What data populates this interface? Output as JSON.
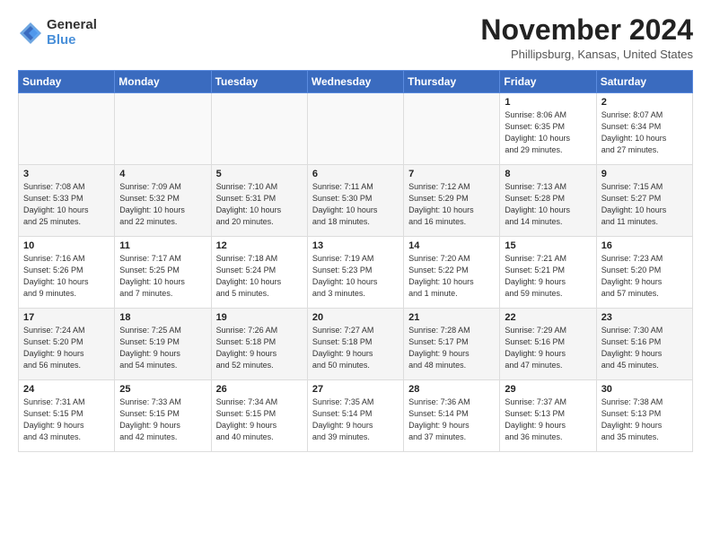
{
  "header": {
    "logo_general": "General",
    "logo_blue": "Blue",
    "month_title": "November 2024",
    "location": "Phillipsburg, Kansas, United States"
  },
  "weekdays": [
    "Sunday",
    "Monday",
    "Tuesday",
    "Wednesday",
    "Thursday",
    "Friday",
    "Saturday"
  ],
  "weeks": [
    [
      {
        "day": "",
        "info": ""
      },
      {
        "day": "",
        "info": ""
      },
      {
        "day": "",
        "info": ""
      },
      {
        "day": "",
        "info": ""
      },
      {
        "day": "",
        "info": ""
      },
      {
        "day": "1",
        "info": "Sunrise: 8:06 AM\nSunset: 6:35 PM\nDaylight: 10 hours\nand 29 minutes."
      },
      {
        "day": "2",
        "info": "Sunrise: 8:07 AM\nSunset: 6:34 PM\nDaylight: 10 hours\nand 27 minutes."
      }
    ],
    [
      {
        "day": "3",
        "info": "Sunrise: 7:08 AM\nSunset: 5:33 PM\nDaylight: 10 hours\nand 25 minutes."
      },
      {
        "day": "4",
        "info": "Sunrise: 7:09 AM\nSunset: 5:32 PM\nDaylight: 10 hours\nand 22 minutes."
      },
      {
        "day": "5",
        "info": "Sunrise: 7:10 AM\nSunset: 5:31 PM\nDaylight: 10 hours\nand 20 minutes."
      },
      {
        "day": "6",
        "info": "Sunrise: 7:11 AM\nSunset: 5:30 PM\nDaylight: 10 hours\nand 18 minutes."
      },
      {
        "day": "7",
        "info": "Sunrise: 7:12 AM\nSunset: 5:29 PM\nDaylight: 10 hours\nand 16 minutes."
      },
      {
        "day": "8",
        "info": "Sunrise: 7:13 AM\nSunset: 5:28 PM\nDaylight: 10 hours\nand 14 minutes."
      },
      {
        "day": "9",
        "info": "Sunrise: 7:15 AM\nSunset: 5:27 PM\nDaylight: 10 hours\nand 11 minutes."
      }
    ],
    [
      {
        "day": "10",
        "info": "Sunrise: 7:16 AM\nSunset: 5:26 PM\nDaylight: 10 hours\nand 9 minutes."
      },
      {
        "day": "11",
        "info": "Sunrise: 7:17 AM\nSunset: 5:25 PM\nDaylight: 10 hours\nand 7 minutes."
      },
      {
        "day": "12",
        "info": "Sunrise: 7:18 AM\nSunset: 5:24 PM\nDaylight: 10 hours\nand 5 minutes."
      },
      {
        "day": "13",
        "info": "Sunrise: 7:19 AM\nSunset: 5:23 PM\nDaylight: 10 hours\nand 3 minutes."
      },
      {
        "day": "14",
        "info": "Sunrise: 7:20 AM\nSunset: 5:22 PM\nDaylight: 10 hours\nand 1 minute."
      },
      {
        "day": "15",
        "info": "Sunrise: 7:21 AM\nSunset: 5:21 PM\nDaylight: 9 hours\nand 59 minutes."
      },
      {
        "day": "16",
        "info": "Sunrise: 7:23 AM\nSunset: 5:20 PM\nDaylight: 9 hours\nand 57 minutes."
      }
    ],
    [
      {
        "day": "17",
        "info": "Sunrise: 7:24 AM\nSunset: 5:20 PM\nDaylight: 9 hours\nand 56 minutes."
      },
      {
        "day": "18",
        "info": "Sunrise: 7:25 AM\nSunset: 5:19 PM\nDaylight: 9 hours\nand 54 minutes."
      },
      {
        "day": "19",
        "info": "Sunrise: 7:26 AM\nSunset: 5:18 PM\nDaylight: 9 hours\nand 52 minutes."
      },
      {
        "day": "20",
        "info": "Sunrise: 7:27 AM\nSunset: 5:18 PM\nDaylight: 9 hours\nand 50 minutes."
      },
      {
        "day": "21",
        "info": "Sunrise: 7:28 AM\nSunset: 5:17 PM\nDaylight: 9 hours\nand 48 minutes."
      },
      {
        "day": "22",
        "info": "Sunrise: 7:29 AM\nSunset: 5:16 PM\nDaylight: 9 hours\nand 47 minutes."
      },
      {
        "day": "23",
        "info": "Sunrise: 7:30 AM\nSunset: 5:16 PM\nDaylight: 9 hours\nand 45 minutes."
      }
    ],
    [
      {
        "day": "24",
        "info": "Sunrise: 7:31 AM\nSunset: 5:15 PM\nDaylight: 9 hours\nand 43 minutes."
      },
      {
        "day": "25",
        "info": "Sunrise: 7:33 AM\nSunset: 5:15 PM\nDaylight: 9 hours\nand 42 minutes."
      },
      {
        "day": "26",
        "info": "Sunrise: 7:34 AM\nSunset: 5:15 PM\nDaylight: 9 hours\nand 40 minutes."
      },
      {
        "day": "27",
        "info": "Sunrise: 7:35 AM\nSunset: 5:14 PM\nDaylight: 9 hours\nand 39 minutes."
      },
      {
        "day": "28",
        "info": "Sunrise: 7:36 AM\nSunset: 5:14 PM\nDaylight: 9 hours\nand 37 minutes."
      },
      {
        "day": "29",
        "info": "Sunrise: 7:37 AM\nSunset: 5:13 PM\nDaylight: 9 hours\nand 36 minutes."
      },
      {
        "day": "30",
        "info": "Sunrise: 7:38 AM\nSunset: 5:13 PM\nDaylight: 9 hours\nand 35 minutes."
      }
    ]
  ]
}
